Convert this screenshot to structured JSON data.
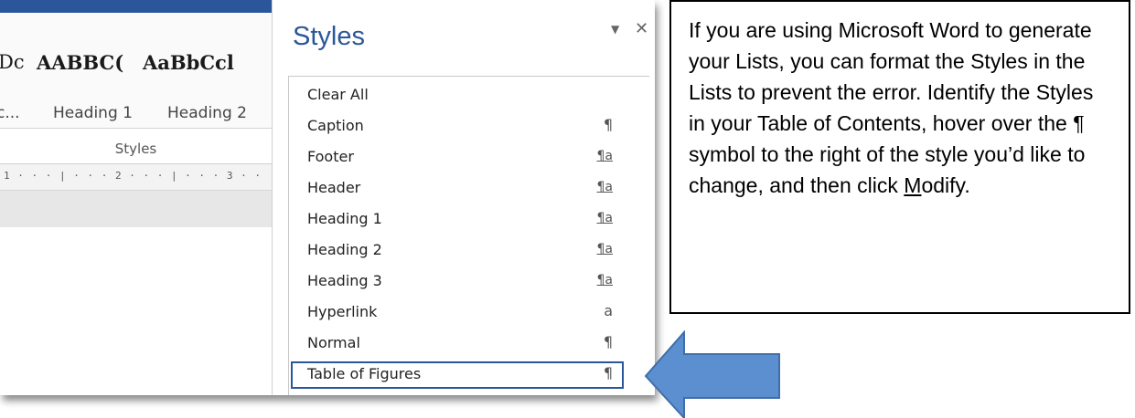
{
  "ribbon": {
    "thumbnails": [
      "Dc",
      "AABBC(",
      "AaBbCcl"
    ],
    "style_names": [
      "c...",
      "Heading 1",
      "Heading 2"
    ],
    "group_label": "Styles",
    "ruler": "1 · · · | · · · 2 · · · | · · · 3 · ·"
  },
  "styles_pane": {
    "title": "Styles",
    "menu_icon": "dropdown-triangle",
    "close_icon": "close-x",
    "items": [
      {
        "label": "Clear All",
        "glyph": ""
      },
      {
        "label": "Caption",
        "glyph": "¶"
      },
      {
        "label": "Footer",
        "glyph": "¶a"
      },
      {
        "label": "Header",
        "glyph": "¶a"
      },
      {
        "label": "Heading 1",
        "glyph": "¶a"
      },
      {
        "label": "Heading 2",
        "glyph": "¶a"
      },
      {
        "label": "Heading 3",
        "glyph": "¶a"
      },
      {
        "label": "Hyperlink",
        "glyph": "a"
      },
      {
        "label": "Normal",
        "glyph": "¶"
      },
      {
        "label": "Table of Figures",
        "glyph": "¶"
      }
    ],
    "selected_item": "Table of Figures"
  },
  "callout": {
    "text_before": "If you are using Microsoft Word to generate your Lists, you can format the Styles in the Lists to prevent the error. Identify the Styles in your Table of Contents, hover over the ¶ symbol to the right of the style you’d like to change, and then click ",
    "underlined_letter": "M",
    "text_after": "odify."
  },
  "colors": {
    "accent": "#2b579a",
    "arrow_fill": "#5b8fd0",
    "arrow_stroke": "#3f6ea8"
  }
}
